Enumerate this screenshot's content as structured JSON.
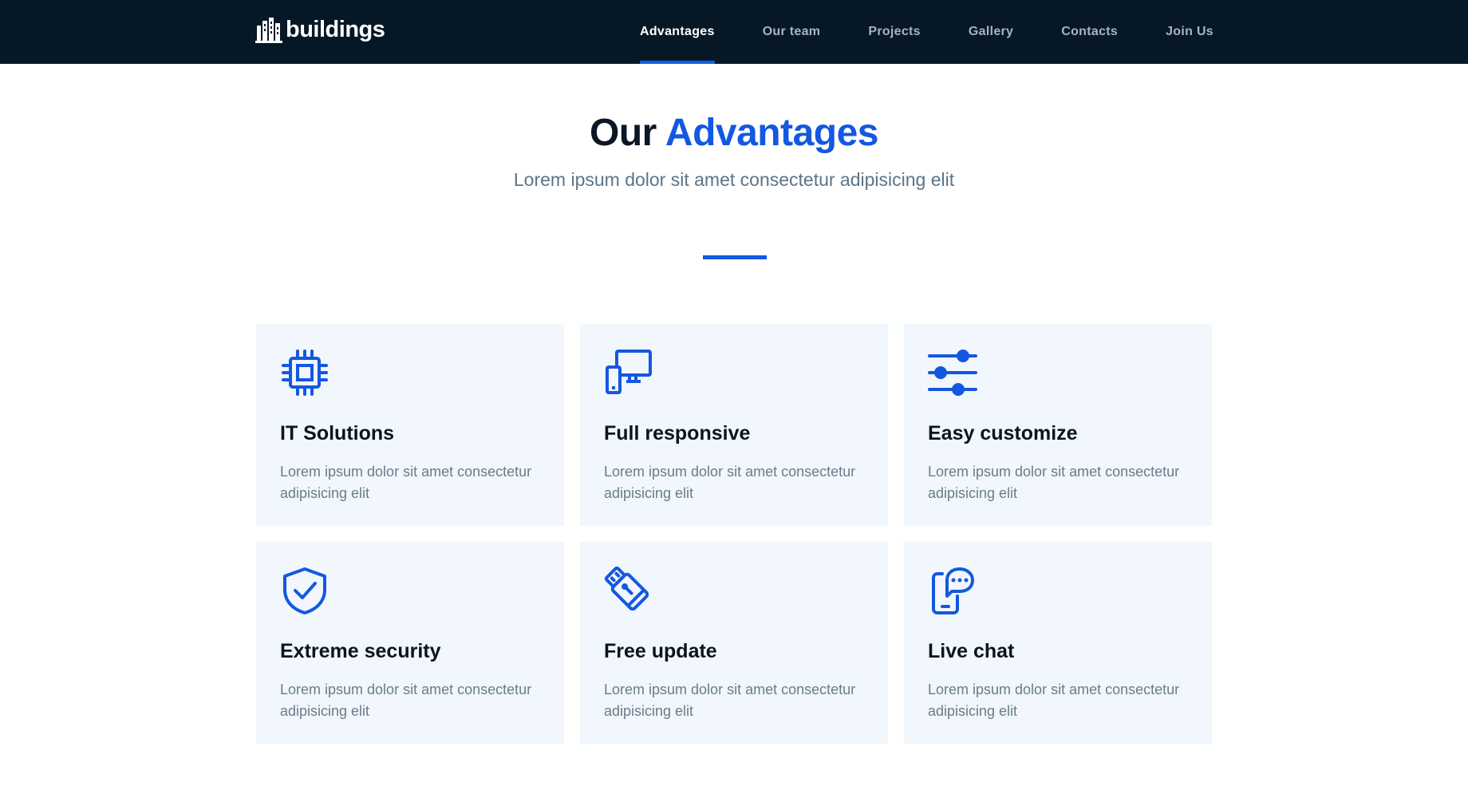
{
  "brand": {
    "name": "buildings",
    "accent_color": "#1358e0",
    "nav_bg": "#061726"
  },
  "nav": {
    "items": [
      {
        "label": "Advantages",
        "active": true
      },
      {
        "label": "Our team"
      },
      {
        "label": "Projects"
      },
      {
        "label": "Gallery"
      },
      {
        "label": "Contacts"
      },
      {
        "label": "Join Us"
      }
    ]
  },
  "section": {
    "title_part1": "Our",
    "title_part2": "Advantages",
    "subtitle": "Lorem ipsum dolor sit amet consectetur adipisicing elit"
  },
  "cards": [
    {
      "icon": "chip-icon",
      "title": "IT Solutions",
      "text": "Lorem ipsum dolor sit amet consectetur adipisicing elit"
    },
    {
      "icon": "devices-icon",
      "title": "Full responsive",
      "text": "Lorem ipsum dolor sit amet consectetur adipisicing elit"
    },
    {
      "icon": "sliders-icon",
      "title": "Easy customize",
      "text": "Lorem ipsum dolor sit amet consectetur adipisicing elit"
    },
    {
      "icon": "shield-check-icon",
      "title": "Extreme security",
      "text": "Lorem ipsum dolor sit amet consectetur adipisicing elit"
    },
    {
      "icon": "usb-drive-icon",
      "title": "Free update",
      "text": "Lorem ipsum dolor sit amet consectetur adipisicing elit"
    },
    {
      "icon": "phone-chat-icon",
      "title": "Live chat",
      "text": "Lorem ipsum dolor sit amet consectetur adipisicing elit"
    }
  ]
}
